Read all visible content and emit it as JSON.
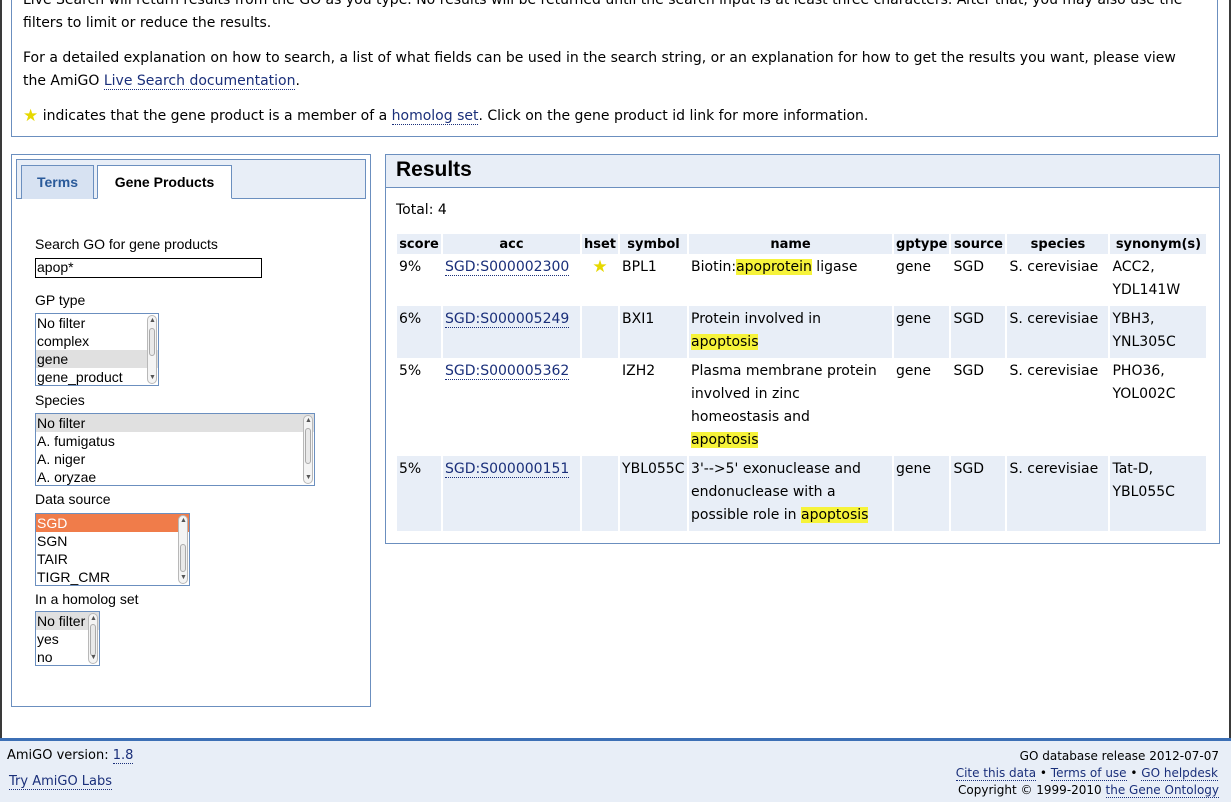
{
  "intro": {
    "p1": "Live Search will return results from the GO as you type. No results will be returned until the search input is at least three characters. After that, you may also use the filters to limit or reduce the results.",
    "p2_before": "For a detailed explanation on how to search, a list of what fields can be used in the search string, or an explanation for how to get the results you want, please view the AmiGO",
    "p2_link": "Live Search documentation",
    "p2_after": ".",
    "p3_star": "★",
    "p3_before": "indicates that the gene product is a member of a",
    "p3_link": "homolog set",
    "p3_after": ". Click on the gene product id link for more information."
  },
  "tabs": [
    {
      "label": "Terms"
    },
    {
      "label": "Gene Products"
    }
  ],
  "filters": {
    "search_label": "Search GO for gene products",
    "search_value": "apop*",
    "gp_type": {
      "label": "GP type",
      "options": [
        "No filter",
        "complex",
        "gene",
        "gene_product"
      ]
    },
    "species": {
      "label": "Species",
      "options": [
        "No filter",
        "A. fumigatus",
        "A. niger",
        "A. oryzae"
      ]
    },
    "data_source": {
      "label": "Data source",
      "options": [
        "SGD",
        "SGN",
        "TAIR",
        "TIGR_CMR"
      ]
    },
    "homolog": {
      "label": "In a homolog set",
      "options": [
        "No filter",
        "yes",
        "no"
      ]
    }
  },
  "results": {
    "title": "Results",
    "total": "Total: 4",
    "columns": [
      "score",
      "acc",
      "hset",
      "symbol",
      "name",
      "gptype",
      "source",
      "species",
      "synonym(s)"
    ],
    "rows": [
      {
        "score": "9%",
        "acc": "SGD:S000002300",
        "hset": "★",
        "symbol": "BPL1",
        "name_pre": "Biotin:",
        "name_hl": "apoprotein",
        "name_post": " ligase",
        "name_pre2": "",
        "gptype": "gene",
        "source": "SGD",
        "species": "S. cerevisiae",
        "syn1": "ACC2,",
        "syn2": "YDL141W"
      },
      {
        "score": "6%",
        "acc": "SGD:S000005249",
        "hset": "",
        "symbol": "BXI1",
        "name_pre": "Protein involved in",
        "name_hl": "apoptosis",
        "name_post": "",
        "name_pre2": "",
        "gptype": "gene",
        "source": "SGD",
        "species": "S. cerevisiae",
        "syn1": "YBH3,",
        "syn2": "YNL305C"
      },
      {
        "score": "5%",
        "acc": "SGD:S000005362",
        "hset": "",
        "symbol": "IZH2",
        "name_pre": "Plasma membrane protein",
        "name_pre2": "involved in zinc",
        "name_pre3": "homeostasis and",
        "name_hl": "apoptosis",
        "name_post": "",
        "gptype": "gene",
        "source": "SGD",
        "species": "S. cerevisiae",
        "syn1": "PHO36,",
        "syn2": "YOL002C"
      },
      {
        "score": "5%",
        "acc": "SGD:S000000151",
        "hset": "",
        "symbol": "YBL055C",
        "name_pre": "3'-->5' exonuclease and",
        "name_pre2": "endonuclease with a",
        "name_pre3": "possible role in ",
        "name_hl": "apoptosis",
        "name_post": "",
        "gptype": "gene",
        "source": "SGD",
        "species": "S. cerevisiae",
        "syn1": "Tat-D,",
        "syn2": "YBL055C"
      }
    ]
  },
  "footer": {
    "version_label": "AmiGO version:",
    "version": "1.8",
    "labs": "Try AmiGO Labs",
    "release": "GO database release 2012-07-07",
    "cite": "Cite this data",
    "bullet": "•",
    "terms": "Terms of use",
    "helpdesk": "GO helpdesk",
    "copyright": "Copyright © 1999-2010",
    "go": "the Gene Ontology"
  }
}
